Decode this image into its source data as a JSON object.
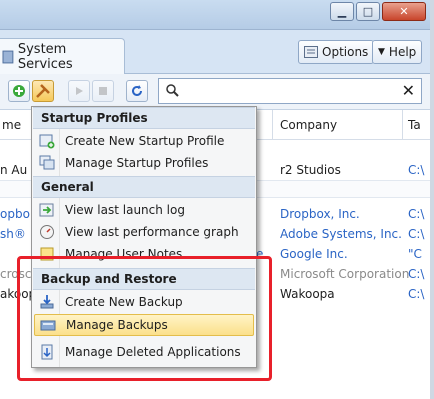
{
  "window": {
    "minimize_glyph": "▁",
    "maximize_glyph": "□",
    "close_glyph": "✕"
  },
  "tab": {
    "label": "System Services"
  },
  "header_buttons": {
    "options": "Options",
    "help": "Help"
  },
  "search": {
    "placeholder": "",
    "clear_glyph": "✕"
  },
  "columns": [
    "me",
    "Company",
    "Ta"
  ],
  "rows": [
    {
      "name": "n Au",
      "company": "r2 Studios",
      "path": "C:\\"
    },
    {
      "name": "opbo",
      "company": "Dropbox, Inc.",
      "path": "C:\\"
    },
    {
      "name": "sh®",
      "company": "Adobe Systems, Inc.",
      "path": "C:\\"
    },
    {
      "name": "e",
      "company": "Google Inc.",
      "path": "\"C"
    },
    {
      "name": "crosc",
      "company": "Microsoft Corporation",
      "path": "C:\\"
    },
    {
      "name": "akoopa",
      "company": "Wakoopa",
      "path": "C:\\"
    }
  ],
  "menu": {
    "sections": [
      {
        "title": "Startup Profiles"
      },
      {
        "title": "General"
      },
      {
        "title": "Backup and Restore"
      }
    ],
    "items": [
      {
        "label": "Create New Startup Profile"
      },
      {
        "label": "Manage Startup Profiles"
      },
      {
        "label": "View last launch log"
      },
      {
        "label": "View last performance graph"
      },
      {
        "label": "Manage User Notes"
      },
      {
        "label": "Create New Backup"
      },
      {
        "label": "Manage Backups"
      },
      {
        "label": "Manage Deleted Applications"
      }
    ]
  },
  "colors": {
    "accent": "#2a64c5",
    "highlight_border": "#e8202a",
    "selected_item": "#fbe08b"
  }
}
